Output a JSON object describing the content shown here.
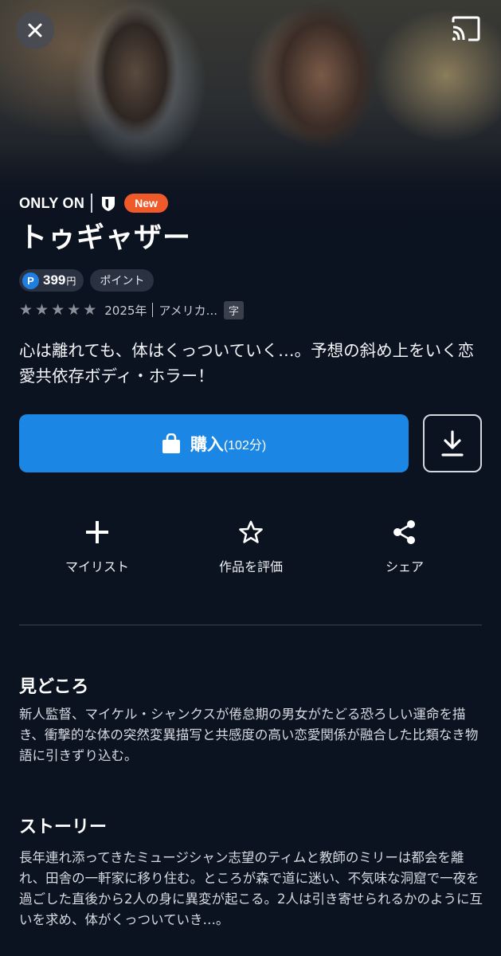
{
  "header": {
    "close_icon": "close-icon",
    "cast_icon": "cast-icon"
  },
  "badges": {
    "only_on": "ONLY ON",
    "new": "New"
  },
  "title": "トゥギャザー",
  "price": {
    "p_mark": "P",
    "amount": "399",
    "unit": "円",
    "tag": "ポイント"
  },
  "meta": {
    "rating_stars": 5,
    "year": "2025年",
    "country": "アメリカ...",
    "subtitle_badge": "字"
  },
  "catchphrase": "心は離れても、体はくっついていく…。予想の斜め上をいく恋愛共依存ボディ・ホラー！",
  "buy": {
    "label": "購入",
    "duration": "(102分)"
  },
  "actions": {
    "mylist": "マイリスト",
    "rate": "作品を評価",
    "share": "シェア"
  },
  "highlights": {
    "heading": "見どころ",
    "body": "新人監督、マイケル・シャンクスが倦怠期の男女がたどる恐ろしい運命を描き、衝撃的な体の突然変異描写と共感度の高い恋愛関係が融合した比類なき物語に引きずり込む。"
  },
  "story": {
    "heading": "ストーリー",
    "body": "長年連れ添ってきたミュージシャン志望のティムと教師のミリーは都会を離れ、田舎の一軒家に移り住む。ところが森で道に迷い、不気味な洞窟で一夜を過ごした直後から2人の身に異変が起こる。2人は引き寄せられるかのように互いを求め、体がくっついていき…。"
  },
  "colors": {
    "background": "#0b1220",
    "accent": "#1b86e3",
    "new_badge": "#ef5a2b"
  }
}
